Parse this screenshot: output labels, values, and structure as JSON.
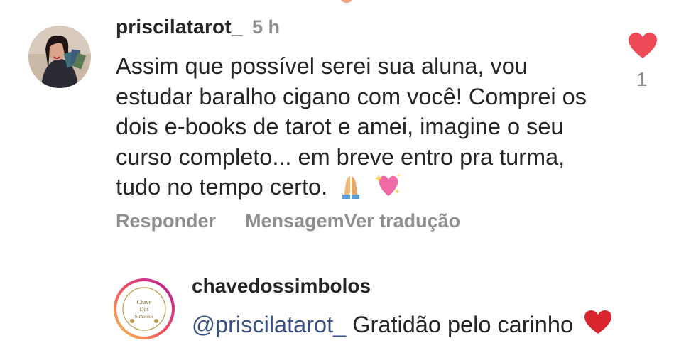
{
  "comment": {
    "username": "priscilatarot_",
    "time": "5 h",
    "text": "Assim que possível serei sua aluna, vou estudar baralho cigano com você! Comprei os dois e-books de tarot e amei, imagine o seu curso completo... em breve entro pra turma, tudo no tempo certo.",
    "emojis": [
      "folded-hands",
      "sparkling-heart"
    ],
    "like_count": "1",
    "actions": {
      "reply": "Responder",
      "message": "Mensagem",
      "translate": "Ver tradução"
    }
  },
  "reply": {
    "username": "chavedossimbolos",
    "mention": "@priscilatarot_",
    "text": "Gratidão pelo carinho",
    "avatar_logo": [
      "Chave",
      "Dos",
      "Símbolos"
    ]
  },
  "colors": {
    "text": "#262626",
    "secondary": "#8e8e8e",
    "like": "#ed4956",
    "mention": "#385185"
  }
}
